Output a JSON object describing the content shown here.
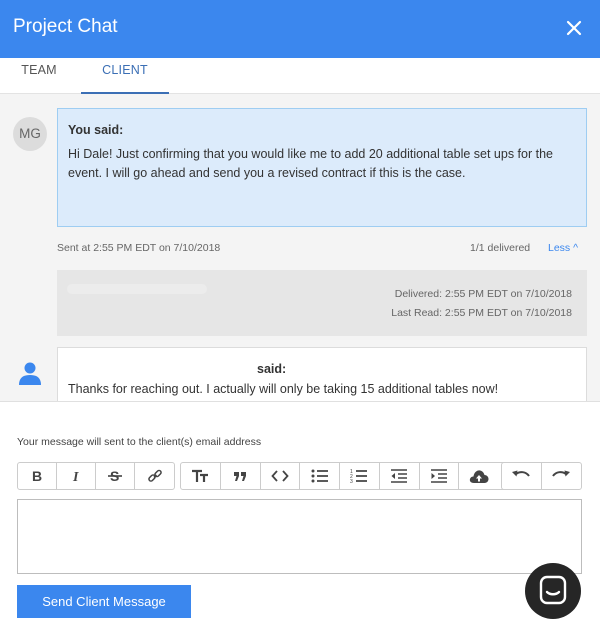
{
  "header": {
    "title": "Project Chat",
    "background": "#3b87ee"
  },
  "tabs": [
    {
      "label": "TEAM",
      "active": false
    },
    {
      "label": "CLIENT",
      "active": true
    }
  ],
  "messages": {
    "outgoing": {
      "avatar_initials": "MG",
      "author": "You said:",
      "text": "Hi Dale! Just confirming that you would like me to add 20 additional table set ups for the event. I will go ahead and send you a revised contract if this is the case.",
      "sent": "Sent at 2:55 PM EDT on 7/10/2018",
      "delivered_count": "1/1 delivered",
      "toggle_label": "Less ^"
    },
    "receipt": {
      "delivered": "Delivered: 2:55 PM EDT on 7/10/2018",
      "last_read": "Last Read: 2:55 PM EDT on 7/10/2018"
    },
    "incoming": {
      "author": "said:",
      "text": "Thanks for reaching out. I actually will only be taking 15 additional tables now!"
    }
  },
  "composer": {
    "notice": "Your message will sent to the client(s) email address",
    "toolbar_icons": [
      "bold-icon",
      "italic-icon",
      "strikethrough-icon",
      "link-icon",
      "text-size-icon",
      "quote-icon",
      "code-icon",
      "bulleted-list-icon",
      "numbered-list-icon",
      "outdent-icon",
      "indent-icon",
      "upload-icon",
      "undo-icon",
      "redo-icon"
    ],
    "message_value": "",
    "send_label": "Send Client Message"
  },
  "colors": {
    "accent": "#3b87ee",
    "outgoing_bubble": "#dcebfb",
    "launcher": "#262626"
  }
}
